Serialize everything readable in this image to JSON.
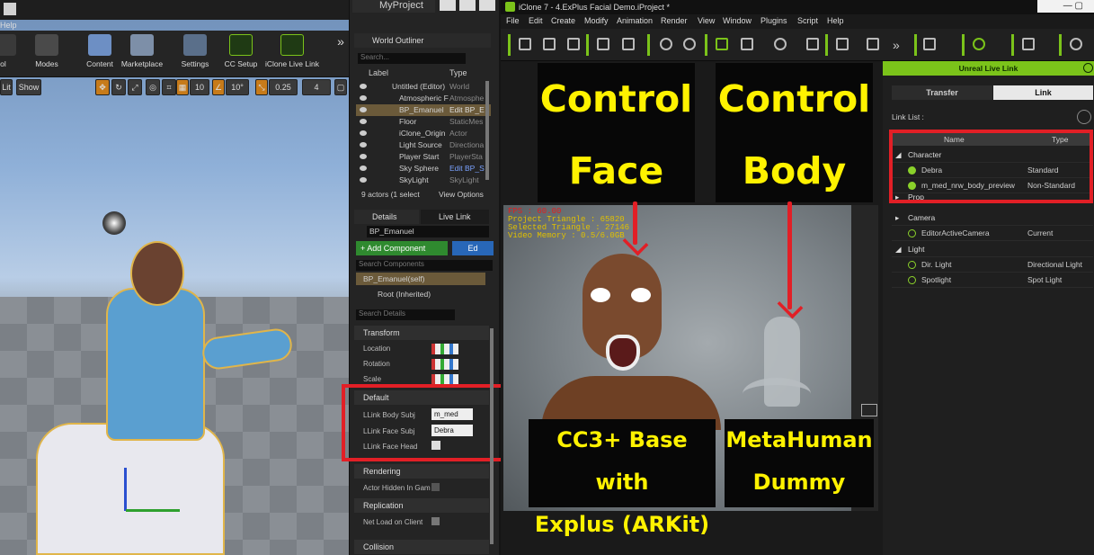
{
  "ue": {
    "title": "MyProject",
    "help": "Help",
    "toolbar": [
      "rol",
      "Modes",
      "Content",
      "Marketplace",
      "Settings",
      "CC Setup",
      "iClone Live Link"
    ],
    "viewport": {
      "lit": "Lit",
      "show": "Show",
      "grid": "10",
      "angle": "10°",
      "scale": "0.25",
      "camera": "4"
    },
    "outliner": {
      "title": "World Outliner",
      "search_placeholder": "Search...",
      "col_label": "Label",
      "col_type": "Type",
      "rows": [
        {
          "label": "Untitled (Editor)",
          "type": "World"
        },
        {
          "label": "Atmospheric F",
          "type": "Atmosphe"
        },
        {
          "label": "BP_Emanuel",
          "type": "Edit BP_E"
        },
        {
          "label": "Floor",
          "type": "StaticMes"
        },
        {
          "label": "iClone_Origin",
          "type": "Actor"
        },
        {
          "label": "Light Source",
          "type": "Directiona"
        },
        {
          "label": "Player Start",
          "type": "PlayerSta"
        },
        {
          "label": "Sky Sphere",
          "type": "Edit BP_S"
        },
        {
          "label": "SkyLight",
          "type": "SkyLight"
        }
      ],
      "footer": "9 actors (1 select",
      "view_options": "View Options"
    },
    "details": {
      "tab_details": "Details",
      "tab_live_link": "Live Link",
      "actor_name": "BP_Emanuel",
      "add_component": "+ Add Component",
      "edit_button": "Ed",
      "search_components": "Search Components",
      "self_component": "BP_Emanuel(self)",
      "root": "Root (Inherited)",
      "search_details": "Search Details",
      "transform": "Transform",
      "location": "Location",
      "rotation": "Rotation",
      "scale": "Scale",
      "default": "Default",
      "llink_body_subj": "LLink Body Subj",
      "body_subj_value": "m_med",
      "llink_face_subj": "LLink Face Subj",
      "face_subj_value": "Debra",
      "llink_face_head": "LLink Face Head",
      "rendering": "Rendering",
      "actor_hidden": "Actor Hidden In Gam",
      "replication": "Replication",
      "net_load": "Net Load on Client",
      "collision": "Collision"
    }
  },
  "iclone": {
    "title": "iClone 7 - 4.ExPlus Facial Demo.iProject *",
    "menu": [
      "File",
      "Edit",
      "Create",
      "Modify",
      "Animation",
      "Render",
      "View",
      "Window",
      "Plugins",
      "Script",
      "Help"
    ],
    "stats": {
      "fps": "FPS : 60.00",
      "triangles": "Project Triangle : 65820",
      "selected": "Selected Triangle : 27146",
      "memory": "Video Memory : 0.5/6.0GB"
    },
    "captions": {
      "control_face_1": "Control",
      "control_face_2": "Face",
      "control_body_1": "Control",
      "control_body_2": "Body",
      "base_1": "CC3+ Base with",
      "base_2": "Explus (ARKit)",
      "meta_1": "MetaHuman",
      "meta_2": "Dummy"
    }
  },
  "live_link": {
    "title": "Unreal Live Link",
    "tab_transfer": "Transfer",
    "tab_link": "Link",
    "link_list": "Link List :",
    "col_name": "Name",
    "col_type": "Type",
    "groups": [
      {
        "name": "Character",
        "items": [
          {
            "name": "Debra",
            "type": "Standard"
          },
          {
            "name": "m_med_nrw_body_preview",
            "type": "Non-Standard"
          }
        ]
      },
      {
        "name": "Prop",
        "items": []
      },
      {
        "name": "Camera",
        "items": [
          {
            "name": "EditorActiveCamera",
            "type": "Current"
          }
        ]
      },
      {
        "name": "Light",
        "items": [
          {
            "name": "Dir. Light",
            "type": "Directional Light"
          },
          {
            "name": "Spotlight",
            "type": "Spot Light"
          }
        ]
      }
    ]
  },
  "colors": {
    "accent_green": "#7bc31a",
    "highlight_red": "#e21f26",
    "caption_yellow": "#fff200"
  }
}
